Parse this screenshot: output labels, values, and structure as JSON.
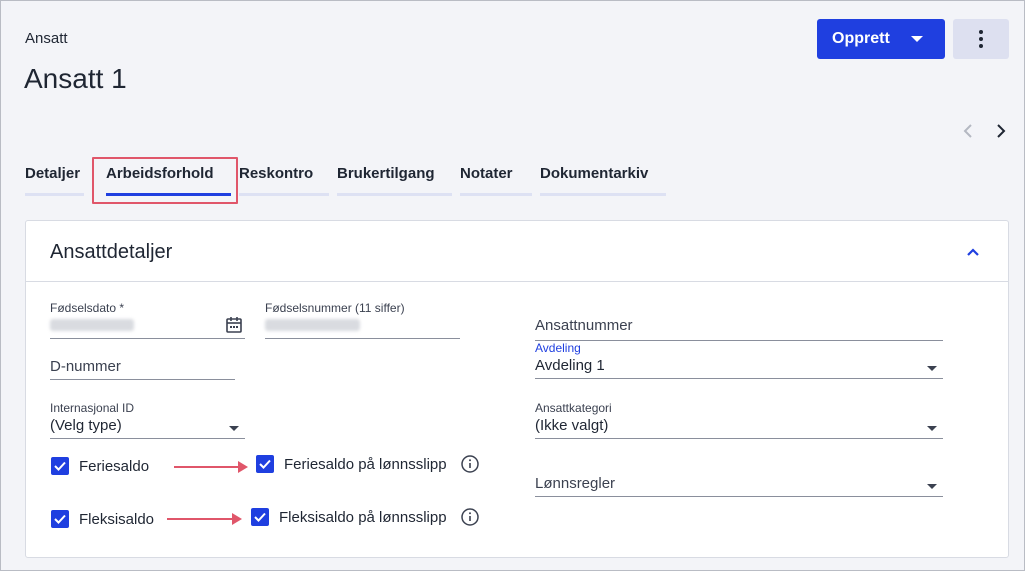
{
  "header": {
    "breadcrumb": "Ansatt",
    "title": "Ansatt 1",
    "create_button_label": "Opprett"
  },
  "tabs": [
    {
      "label": "Detaljer",
      "active": false
    },
    {
      "label": "Arbeidsforhold",
      "active": true
    },
    {
      "label": "Reskontro",
      "active": false
    },
    {
      "label": "Brukertilgang",
      "active": false
    },
    {
      "label": "Notater",
      "active": false
    },
    {
      "label": "Dokumentarkiv",
      "active": false
    }
  ],
  "card": {
    "title": "Ansattdetaljer",
    "fields": {
      "birthdate_label": "Fødselsdato *",
      "ssn_label": "Fødselsnummer (11 siffer)",
      "employee_number_placeholder": "Ansattnummer",
      "d_number_placeholder": "D-nummer",
      "department_label": "Avdeling",
      "department_value": "Avdeling 1",
      "intl_id_label": "Internasjonal ID",
      "intl_id_value": "(Velg type)",
      "category_label": "Ansattkategori",
      "category_value": "(Ikke valgt)",
      "salary_rules_placeholder": "Lønnsregler"
    },
    "checkboxes": {
      "vacation_balance": {
        "label": "Feriesaldo",
        "checked": true
      },
      "vacation_balance_payslip": {
        "label": "Feriesaldo på lønnsslipp",
        "checked": true
      },
      "flex_balance": {
        "label": "Fleksisaldo",
        "checked": true
      },
      "flex_balance_payslip": {
        "label": "Fleksisaldo på lønnsslipp",
        "checked": true
      }
    }
  },
  "colors": {
    "accent": "#1f3fe0",
    "highlight": "#e0566a"
  }
}
